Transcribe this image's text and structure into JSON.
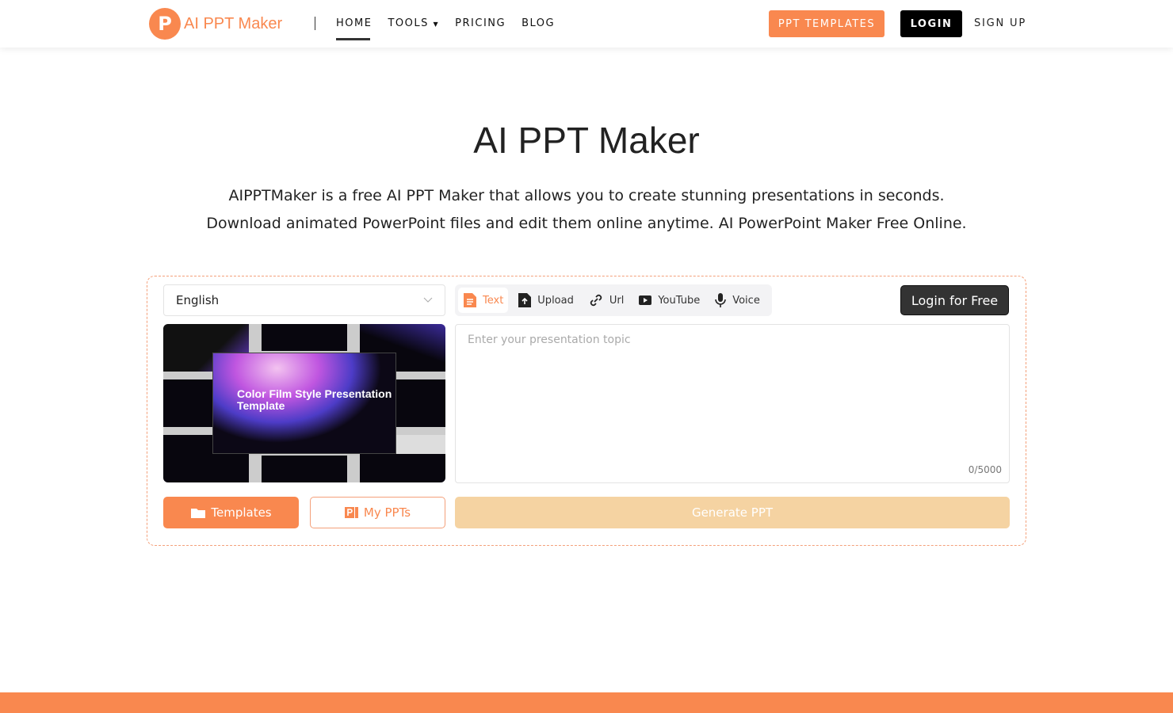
{
  "nav": {
    "logo_letter": "P",
    "logo_text": "AI PPT Maker",
    "items": [
      "HOME",
      "TOOLS",
      "PRICING",
      "BLOG"
    ],
    "ppt_templates": "PPT TEMPLATES",
    "login": "LOGIN",
    "signup": "SIGN UP"
  },
  "hero": {
    "title": "AI PPT Maker",
    "line1": "AIPPTMaker is a free AI PPT Maker that allows you to create stunning presentations in seconds.",
    "line2": "Download animated PowerPoint files and edit them online anytime. AI PowerPoint Maker Free Online."
  },
  "panel": {
    "language": "English",
    "tabs": [
      "Text",
      "Upload",
      "Url",
      "YouTube",
      "Voice"
    ],
    "login_free": "Login for Free",
    "preview_title": "Color Film Style Presentation Template",
    "placeholder": "Enter your presentation topic",
    "count": "0/5000",
    "templates": "Templates",
    "my_ppts": "My PPTs",
    "generate": "Generate PPT"
  },
  "colors": {
    "accent": "#f9884f",
    "generate_disabled": "#f5d3a2"
  }
}
